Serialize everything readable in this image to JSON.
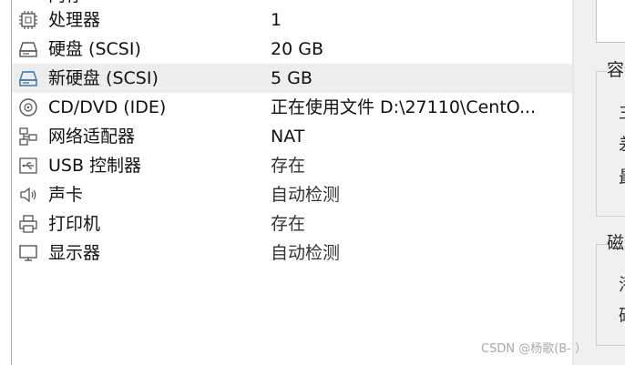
{
  "devices": [
    {
      "name": "内存",
      "value": "",
      "icon": "memory-icon"
    },
    {
      "name": "处理器",
      "value": "1",
      "icon": "cpu-icon"
    },
    {
      "name": "硬盘 (SCSI)",
      "value": "20 GB",
      "icon": "hard-disk-icon"
    },
    {
      "name": "新硬盘 (SCSI)",
      "value": "5 GB",
      "icon": "hard-disk-new-icon",
      "selected": true
    },
    {
      "name": "CD/DVD (IDE)",
      "value": "正在使用文件 D:\\27110\\CentO...",
      "icon": "cd-dvd-icon"
    },
    {
      "name": "网络适配器",
      "value": "NAT",
      "icon": "network-adapter-icon"
    },
    {
      "name": "USB 控制器",
      "value": "存在",
      "icon": "usb-icon"
    },
    {
      "name": "声卡",
      "value": "自动检测",
      "icon": "speaker-icon"
    },
    {
      "name": "打印机",
      "value": "存在",
      "icon": "printer-icon"
    },
    {
      "name": "显示器",
      "value": "自动检测",
      "icon": "monitor-icon"
    }
  ],
  "right_panel": {
    "group1_label": "容",
    "group1_chars": [
      "主",
      "差",
      "最"
    ],
    "group2_label": "磁",
    "group2_chars": [
      "潘",
      "碛"
    ]
  },
  "watermark": "CSDN @杨歌(B- ）"
}
